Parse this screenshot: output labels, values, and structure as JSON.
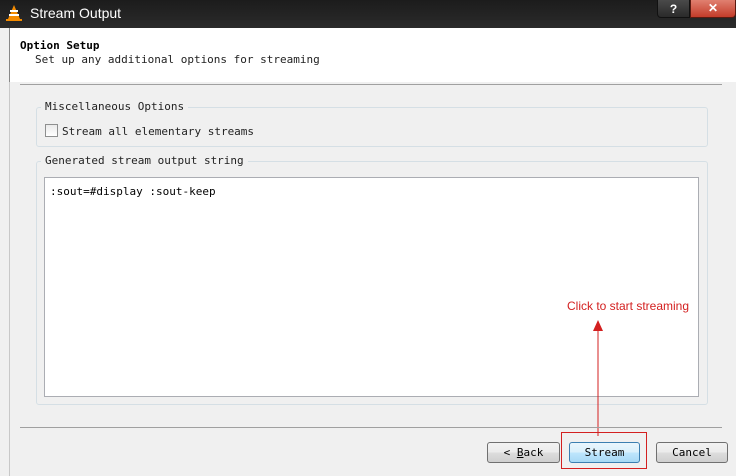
{
  "window": {
    "title": "Stream Output",
    "help_label": "?",
    "close_label": "✕"
  },
  "header": {
    "title": "Option Setup",
    "subtitle": "Set up any additional options for streaming"
  },
  "misc_options": {
    "label": "Miscellaneous Options",
    "checkbox_label": "Stream all elementary streams",
    "checked": false
  },
  "output_string": {
    "label": "Generated stream output string",
    "value": ":sout=#display :sout-keep"
  },
  "annotation": {
    "text": "Click to start streaming",
    "color": "#d32020"
  },
  "buttons": {
    "back_prefix": "< ",
    "back_mnemonic": "B",
    "back_rest": "ack",
    "stream": "Stream",
    "cancel": "Cancel"
  }
}
